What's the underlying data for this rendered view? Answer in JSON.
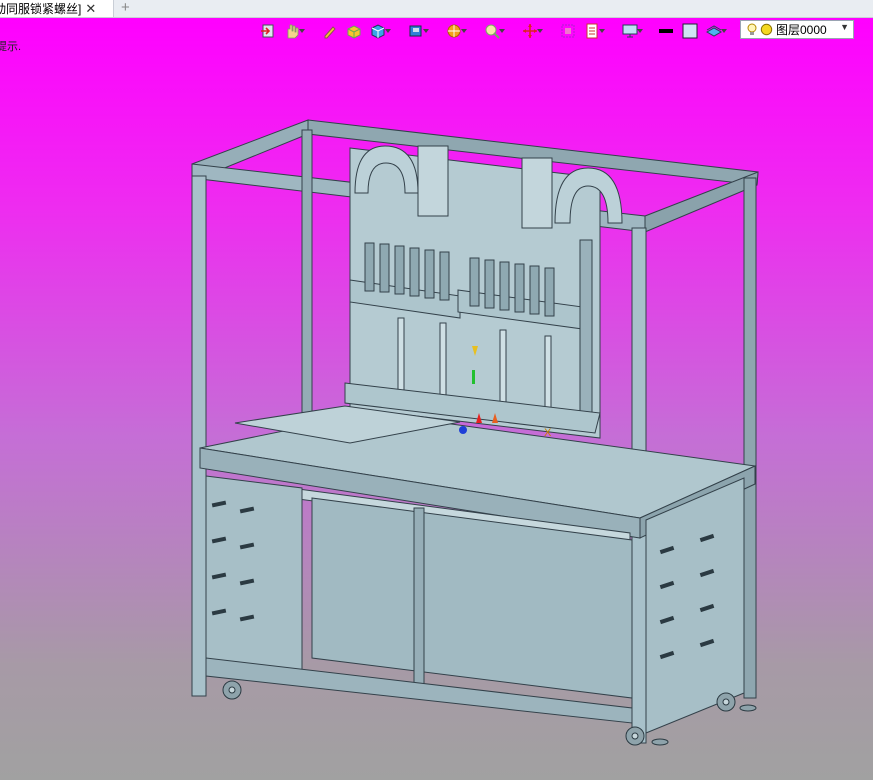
{
  "document_tab": {
    "title": "动同服锁紧螺丝]",
    "close_glyph": "✕",
    "add_glyph": "+"
  },
  "viewport": {
    "hint": "提示."
  },
  "toolbar": {
    "icons": [
      "import-icon",
      "hand-icon",
      "pen-icon",
      "cube-yellow-icon",
      "cube-blue-icon",
      "book-icon",
      "ball-icon",
      "magnifier-icon",
      "move-cross-icon",
      "frame-icon",
      "sheet-icon",
      "monitor-icon",
      "line-weight-icon",
      "color-square-icon",
      "layer-stack-icon"
    ]
  },
  "layer_selector": {
    "value": "图层0000",
    "arrow": "▼",
    "icons": [
      "bulb-icon",
      "sun-icon"
    ]
  },
  "colors": {
    "viewport_top": "#ff00ff",
    "viewport_bottom": "#a1a1a1",
    "model_steel": "#a3bcc4",
    "model_outline": "#33414a"
  }
}
